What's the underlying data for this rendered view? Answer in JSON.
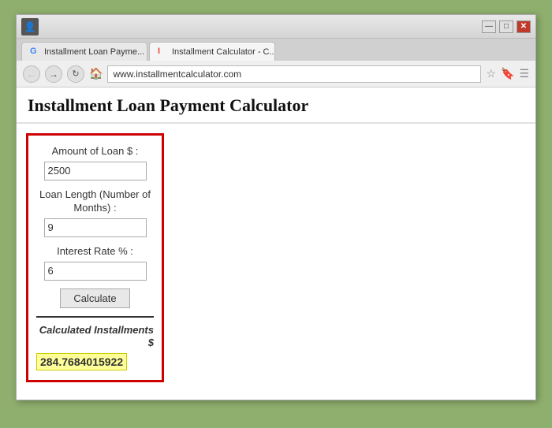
{
  "browser": {
    "tabs": [
      {
        "label": "Installment Loan Payme...",
        "favicon": "G",
        "active": false
      },
      {
        "label": "Installment Calculator - C...",
        "favicon": "I",
        "active": true
      }
    ],
    "url": "www.installmentcalculator.com",
    "window_controls": {
      "user_icon": "👤",
      "minimize": "—",
      "maximize": "□",
      "close": "✕"
    }
  },
  "page": {
    "title": "Installment Loan Payment Calculator"
  },
  "calculator": {
    "amount_label": "Amount of Loan $ :",
    "amount_value": "2500",
    "loan_length_label": "Loan Length (Number of Months) :",
    "loan_length_value": "9",
    "interest_rate_label": "Interest Rate % :",
    "interest_rate_value": "6",
    "calculate_button": "Calculate",
    "result_label": "Calculated Installments $",
    "result_value": "284.7684015922"
  }
}
